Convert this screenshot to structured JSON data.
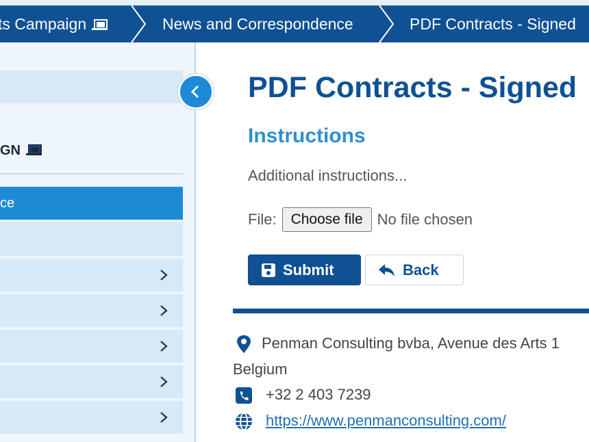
{
  "breadcrumb": {
    "items": [
      {
        "label": "ts Campaign"
      },
      {
        "label": "News and Correspondence"
      },
      {
        "label": "PDF Contracts - Signed"
      }
    ]
  },
  "sidebar": {
    "campaign_label": "GN",
    "active_item": "ce"
  },
  "main": {
    "title": "PDF Contracts - Signed",
    "subtitle": "Instructions",
    "instructions": "Additional instructions...",
    "file_label": "File:",
    "file_button": "Choose file",
    "file_status": "No file chosen",
    "submit_label": "Submit",
    "back_label": "Back"
  },
  "contact": {
    "address_line1": "Penman Consulting bvba, Avenue des Arts 1",
    "address_line2": "Belgium",
    "phone": "+32 2 403 7239",
    "website": "https://www.penmanconsulting.com/"
  },
  "icons": {
    "laptop": "laptop-icon",
    "chevron": "chevron-right-icon",
    "collapse": "chevron-left-icon",
    "save": "floppy-disk-icon",
    "back": "reply-arrow-icon",
    "location": "map-marker-icon",
    "phone": "phone-square-icon",
    "web": "globe-icon"
  },
  "colors": {
    "brand": "#0f5193",
    "accent": "#1d8ad6",
    "sidebar_bg": "#eef5fb"
  }
}
